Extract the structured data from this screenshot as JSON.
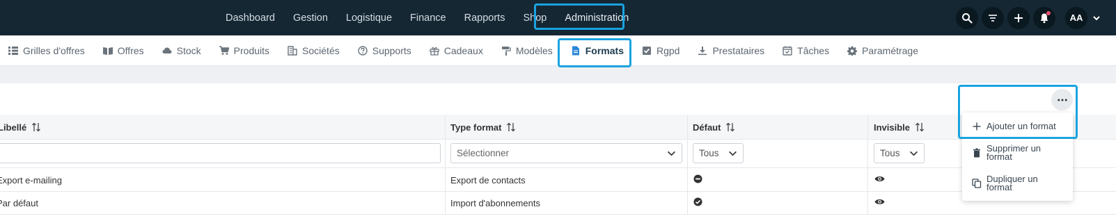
{
  "topnav": {
    "items": [
      {
        "label": "Dashboard"
      },
      {
        "label": "Gestion"
      },
      {
        "label": "Logistique"
      },
      {
        "label": "Finance"
      },
      {
        "label": "Rapports"
      },
      {
        "label": "Shop"
      },
      {
        "label": "Administration",
        "active": true
      }
    ],
    "avatar_initials": "AA"
  },
  "subnav": {
    "items": [
      {
        "label": "Grilles d'offres",
        "icon": "grid-icon"
      },
      {
        "label": "Offres",
        "icon": "book-icon"
      },
      {
        "label": "Stock",
        "icon": "cloud-icon"
      },
      {
        "label": "Produits",
        "icon": "cart-icon"
      },
      {
        "label": "Sociétés",
        "icon": "building-icon"
      },
      {
        "label": "Supports",
        "icon": "help-circle-icon"
      },
      {
        "label": "Cadeaux",
        "icon": "gift-icon"
      },
      {
        "label": "Modèles",
        "icon": "paint-roller-icon"
      },
      {
        "label": "Formats",
        "icon": "file-icon",
        "active": true
      },
      {
        "label": "Rgpd",
        "icon": "check-square-icon"
      },
      {
        "label": "Prestataires",
        "icon": "download-icon"
      },
      {
        "label": "Tâches",
        "icon": "calendar-check-icon"
      },
      {
        "label": "Paramétrage",
        "icon": "gear-icon"
      }
    ]
  },
  "table": {
    "columns": [
      {
        "label": "Libellé"
      },
      {
        "label": "Type format"
      },
      {
        "label": "Défaut"
      },
      {
        "label": "Invisible"
      }
    ],
    "filters": {
      "libelle_value": "",
      "type_placeholder": "Sélectionner",
      "defaut_value": "Tous",
      "invisible_value": "Tous"
    },
    "rows": [
      {
        "libelle": "Export e-mailing",
        "type": "Export de contacts",
        "defaut": "minus-circle-icon",
        "invisible": "eye-icon"
      },
      {
        "libelle": "Par défaut",
        "type": "Import d'abonnements",
        "defaut": "check-circle-icon",
        "invisible": "eye-icon"
      }
    ]
  },
  "menu": {
    "items": [
      {
        "label": "Ajouter un format",
        "icon": "plus-icon"
      },
      {
        "label": "Supprimer un format",
        "icon": "trash-icon"
      },
      {
        "label": "Dupliquer un format",
        "icon": "copy-icon"
      }
    ]
  },
  "colors": {
    "topbar": "#152733",
    "highlight": "#1aa3e0",
    "active_icon": "#2a86d8"
  }
}
